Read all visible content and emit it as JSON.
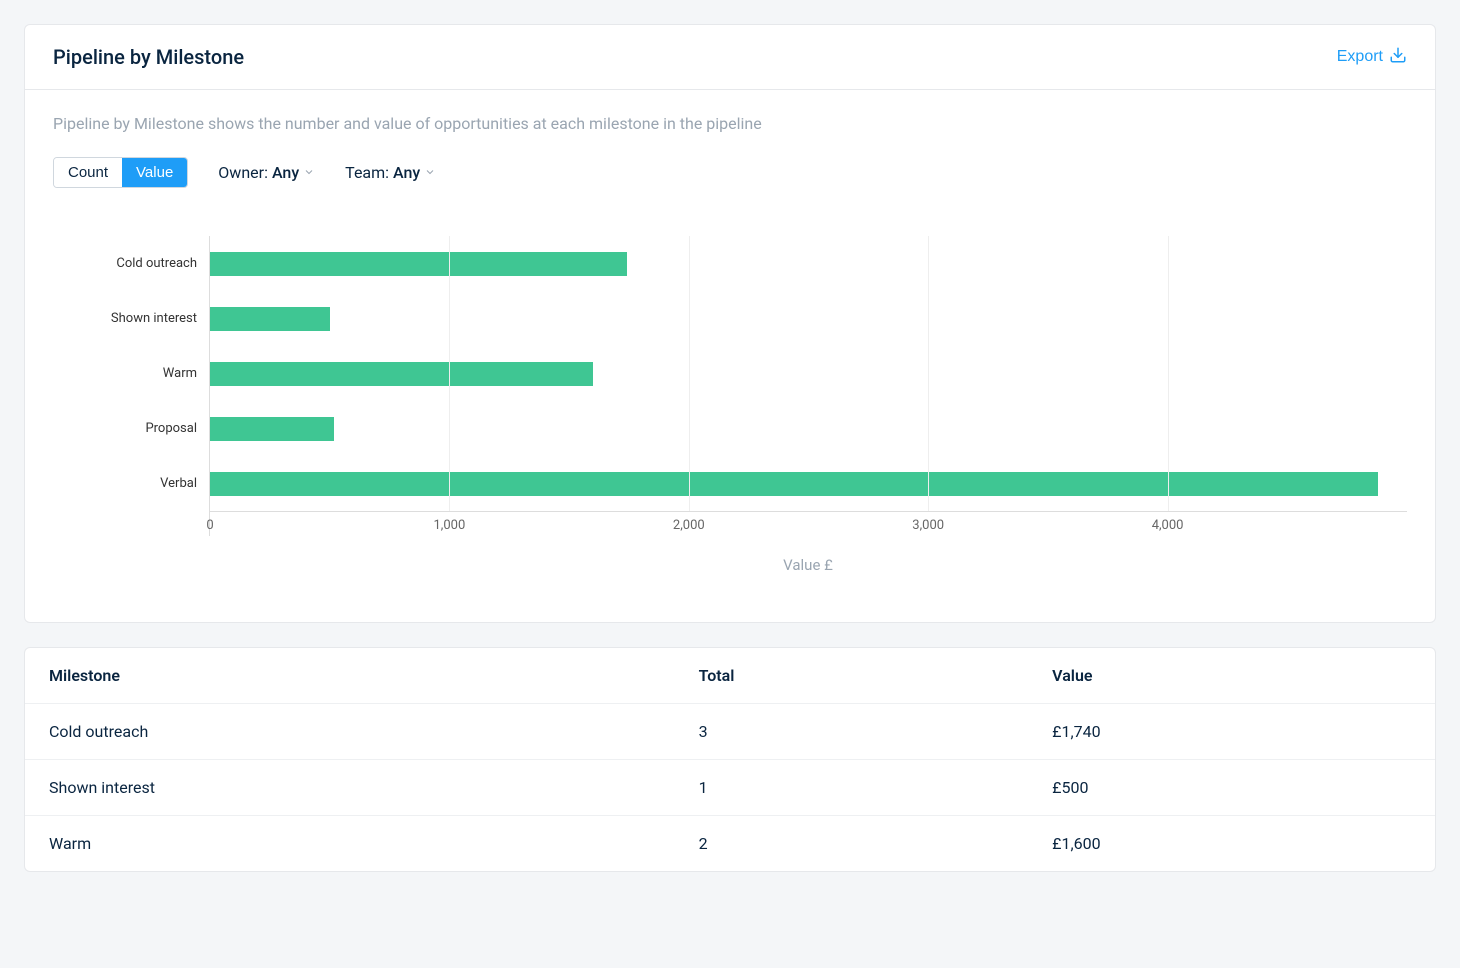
{
  "header": {
    "title": "Pipeline by Milestone",
    "export_label": "Export"
  },
  "description": "Pipeline by Milestone shows the number and value of opportunities at each milestone in the pipeline",
  "controls": {
    "toggle": {
      "count_label": "Count",
      "value_label": "Value",
      "active": "value"
    },
    "owner": {
      "label": "Owner:",
      "value": "Any"
    },
    "team": {
      "label": "Team:",
      "value": "Any"
    }
  },
  "chart_data": {
    "type": "bar",
    "orientation": "horizontal",
    "categories": [
      "Cold outreach",
      "Shown interest",
      "Warm",
      "Proposal",
      "Verbal"
    ],
    "values": [
      1740,
      500,
      1600,
      520,
      4880
    ],
    "xlabel": "Value £",
    "ylabel": "",
    "xlim": [
      0,
      5000
    ],
    "xticks": [
      0,
      1000,
      2000,
      3000,
      4000
    ],
    "xtick_labels": [
      "0",
      "1,000",
      "2,000",
      "3,000",
      "4,000"
    ],
    "bar_color": "#3FC693"
  },
  "table": {
    "columns": [
      "Milestone",
      "Total",
      "Value"
    ],
    "rows": [
      {
        "milestone": "Cold outreach",
        "total": "3",
        "value": "£1,740"
      },
      {
        "milestone": "Shown interest",
        "total": "1",
        "value": "£500"
      },
      {
        "milestone": "Warm",
        "total": "2",
        "value": "£1,600"
      }
    ]
  }
}
